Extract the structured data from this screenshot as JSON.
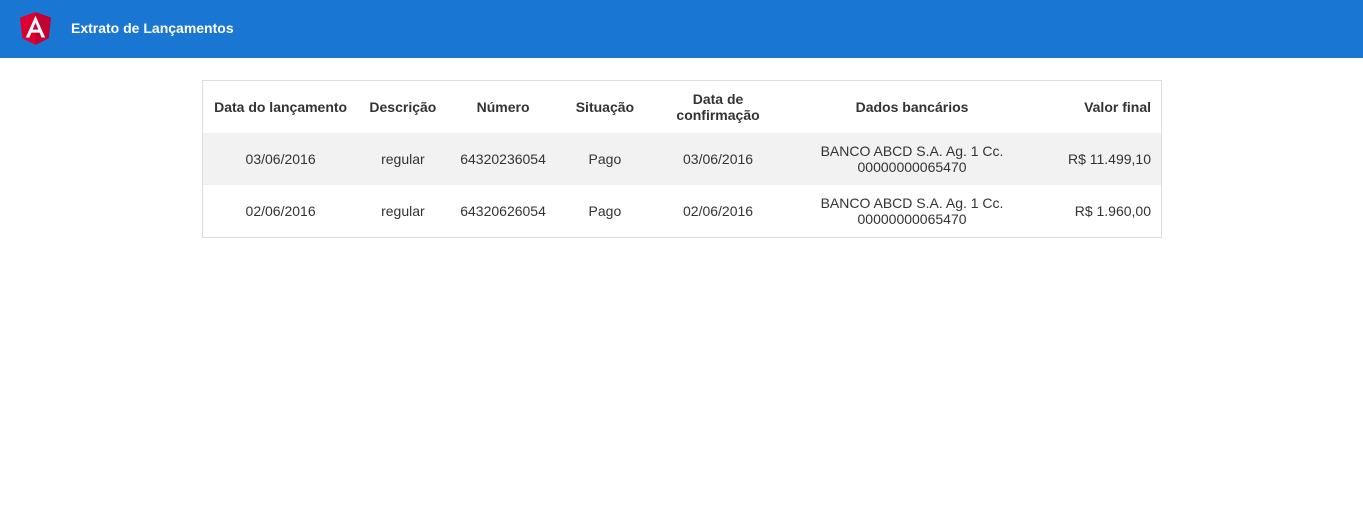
{
  "header": {
    "title": "Extrato de Lançamentos",
    "logo_icon": "angular-logo-icon",
    "background_color": "#1976d2"
  },
  "table": {
    "columns": [
      "Data do lançamento",
      "Descrição",
      "Número",
      "Situação",
      "Data de confirmação",
      "Dados bancários",
      "Valor final"
    ],
    "rows": [
      {
        "data_lancamento": "03/06/2016",
        "descricao": "regular",
        "numero": "64320236054",
        "situacao": "Pago",
        "data_confirmacao": "03/06/2016",
        "dados_bancarios": "BANCO ABCD S.A. Ag. 1 Cc. 00000000065470",
        "valor_final": "R$ 11.499,10"
      },
      {
        "data_lancamento": "02/06/2016",
        "descricao": "regular",
        "numero": "64320626054",
        "situacao": "Pago",
        "data_confirmacao": "02/06/2016",
        "dados_bancarios": "BANCO ABCD S.A. Ag. 1 Cc. 00000000065470",
        "valor_final": "R$ 1.960,00"
      }
    ]
  }
}
